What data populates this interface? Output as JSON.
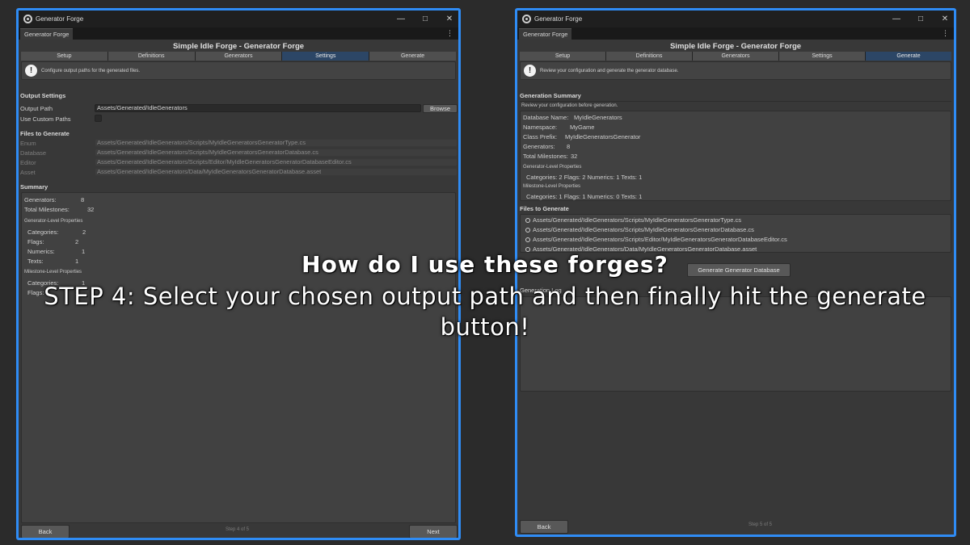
{
  "left_window": {
    "title": "Generator Forge",
    "doc_tab": "Generator Forge",
    "forge_title": "Simple Idle Forge - Generator Forge",
    "tabs": [
      "Setup",
      "Definitions",
      "Generators",
      "Settings",
      "Generate"
    ],
    "active_tab": "Settings",
    "help_text": "Configure output paths for the generated files.",
    "output_settings": {
      "heading": "Output Settings",
      "output_path_label": "Output Path",
      "output_path_value": "Assets/Generated/IdleGenerators",
      "browse_label": "Browse",
      "use_custom_paths_label": "Use Custom Paths",
      "use_custom_paths_checked": false
    },
    "files_to_generate": {
      "heading": "Files to Generate",
      "rows": [
        {
          "label": "Enum",
          "path": "Assets/Generated/IdleGenerators/Scripts/MyIdleGeneratorsGeneratorType.cs"
        },
        {
          "label": "Database",
          "path": "Assets/Generated/IdleGenerators/Scripts/MyIdleGeneratorsGeneratorDatabase.cs"
        },
        {
          "label": "Editor",
          "path": "Assets/Generated/IdleGenerators/Scripts/Editor/MyIdleGeneratorsGeneratorDatabaseEditor.cs"
        },
        {
          "label": "Asset",
          "path": "Assets/Generated/IdleGenerators/Data/MyIdleGeneratorsGeneratorDatabase.asset"
        }
      ]
    },
    "summary": {
      "heading": "Summary",
      "generators_label": "Generators:",
      "generators_value": "8",
      "milestones_label": "Total Milestones:",
      "milestones_value": "32",
      "gen_props_heading": "Generator-Level Properties",
      "gen_props": [
        {
          "label": "Categories:",
          "value": "2"
        },
        {
          "label": "Flags:",
          "value": "2"
        },
        {
          "label": "Numerics:",
          "value": "1"
        },
        {
          "label": "Texts:",
          "value": "1"
        }
      ],
      "ms_props_heading": "Milestone-Level Properties",
      "ms_props": [
        {
          "label": "Categories:",
          "value": "1"
        },
        {
          "label": "Flags:",
          "value": "1"
        }
      ]
    },
    "footer": {
      "back_label": "Back",
      "step_text": "Step 4 of 5",
      "next_label": "Next"
    }
  },
  "right_window": {
    "title": "Generator Forge",
    "doc_tab": "Generator Forge",
    "forge_title": "Simple Idle Forge - Generator Forge",
    "tabs": [
      "Setup",
      "Definitions",
      "Generators",
      "Settings",
      "Generate"
    ],
    "active_tab": "Generate",
    "help_text": "Review your configuration and generate the generator database.",
    "generation_summary": {
      "heading": "Generation Summary",
      "note": "Review your configuration before generation.",
      "rows": [
        {
          "label": "Database Name:",
          "value": "MyIdleGenerators"
        },
        {
          "label": "Namespace:",
          "value": "MyGame"
        },
        {
          "label": "Class Prefix:",
          "value": "MyIdleGeneratorsGenerator"
        },
        {
          "label": "Generators:",
          "value": "8"
        },
        {
          "label": "Total Milestones:",
          "value": "32"
        }
      ],
      "gen_props_heading": "Generator-Level Properties",
      "gen_props_line": "Categories: 2  Flags: 2  Numerics: 1  Texts: 1",
      "ms_props_heading": "Milestone-Level Properties",
      "ms_props_line": "Categories: 1  Flags: 1  Numerics: 0  Texts: 1"
    },
    "files_to_generate": {
      "heading": "Files to Generate",
      "files": [
        "Assets/Generated/IdleGenerators/Scripts/MyIdleGeneratorsGeneratorType.cs",
        "Assets/Generated/IdleGenerators/Scripts/MyIdleGeneratorsGeneratorDatabase.cs",
        "Assets/Generated/IdleGenerators/Scripts/Editor/MyIdleGeneratorsGeneratorDatabaseEditor.cs",
        "Assets/Generated/IdleGenerators/Data/MyIdleGeneratorsGeneratorDatabase.asset"
      ]
    },
    "generate_button_label": "Generate Generator Database",
    "generation_log_heading": "Generation Log",
    "footer": {
      "back_label": "Back",
      "step_text": "Step 5 of 5"
    }
  },
  "overlay": {
    "question": "How do I use these forges?",
    "step_text": "STEP 4: Select your chosen output path and then finally hit the generate button!"
  },
  "colors": {
    "window_border": "#2f8cf5",
    "active_tab": "#2c4666",
    "panel_bg": "#383838",
    "page_bg": "#2b2b2b"
  },
  "icons": {
    "app": "unity-gear-icon",
    "help": "info-exclamation-icon",
    "menu": "kebab-menu-icon",
    "minimize": "minimize-icon",
    "maximize": "maximize-icon",
    "close": "close-icon",
    "file": "radio-circle-icon"
  }
}
